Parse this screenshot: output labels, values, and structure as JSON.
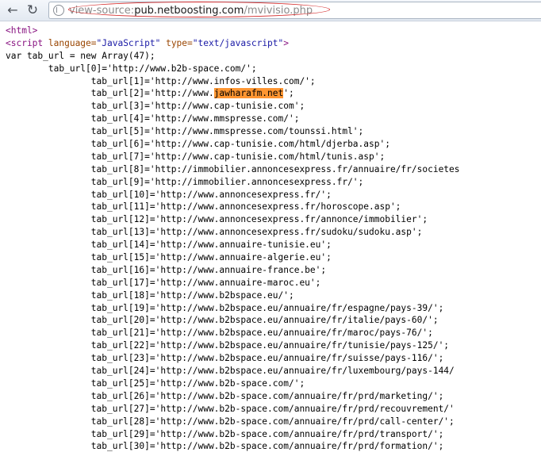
{
  "toolbar": {
    "back_icon": "back-arrow-icon",
    "reload_icon": "reload-icon",
    "page_icon": "page-info-icon"
  },
  "address": {
    "scheme": "view-source:",
    "host": "pub.netboosting.com",
    "path": "/mvivisio.php",
    "highlight_color": "#d42a2a"
  },
  "source": {
    "html_open": "<html>",
    "script_open": "<script language=\"JavaScript\" type=\"text/javascript\">",
    "array_decl": "var tab_url = new Array(47);",
    "first_line": "        tab_url[0]='http://www.b2b-space.com/';",
    "highlight_term": "jawharafm.net",
    "highlight_color": "#ff9632",
    "entries": [
      "tab_url[1]='http://www.infos-villes.com/';",
      "tab_url[2]='http://www.jawharafm.net';",
      "tab_url[3]='http://www.cap-tunisie.com';",
      "tab_url[4]='http://www.mmspresse.com/';",
      "tab_url[5]='http://www.mmspresse.com/tounssi.html';",
      "tab_url[6]='http://www.cap-tunisie.com/html/djerba.asp';",
      "tab_url[7]='http://www.cap-tunisie.com/html/tunis.asp';",
      "tab_url[8]='http://immobilier.annoncesexpress.fr/annuaire/fr/societes",
      "tab_url[9]='http://immobilier.annoncesexpress.fr/';",
      "tab_url[10]='http://www.annoncesexpress.fr/';",
      "tab_url[11]='http://www.annoncesexpress.fr/horoscope.asp';",
      "tab_url[12]='http://www.annoncesexpress.fr/annonce/immobilier';",
      "tab_url[13]='http://www.annoncesexpress.fr/sudoku/sudoku.asp';",
      "tab_url[14]='http://www.annuaire-tunisie.eu';",
      "tab_url[15]='http://www.annuaire-algerie.eu';",
      "tab_url[16]='http://www.annuaire-france.be';",
      "tab_url[17]='http://www.annuaire-maroc.eu';",
      "tab_url[18]='http://www.b2bspace.eu/';",
      "tab_url[19]='http://www.b2bspace.eu/annuaire/fr/espagne/pays-39/';",
      "tab_url[20]='http://www.b2bspace.eu/annuaire/fr/italie/pays-60/';",
      "tab_url[21]='http://www.b2bspace.eu/annuaire/fr/maroc/pays-76/';",
      "tab_url[22]='http://www.b2bspace.eu/annuaire/fr/tunisie/pays-125/';",
      "tab_url[23]='http://www.b2bspace.eu/annuaire/fr/suisse/pays-116/';",
      "tab_url[24]='http://www.b2bspace.eu/annuaire/fr/luxembourg/pays-144/",
      "tab_url[25]='http://www.b2b-space.com/';",
      "tab_url[26]='http://www.b2b-space.com/annuaire/fr/prd/marketing/';",
      "tab_url[27]='http://www.b2b-space.com/annuaire/fr/prd/recouvrement/'",
      "tab_url[28]='http://www.b2b-space.com/annuaire/fr/prd/call-center/';",
      "tab_url[29]='http://www.b2b-space.com/annuaire/fr/prd/transport/';",
      "tab_url[30]='http://www.b2b-space.com/annuaire/fr/prd/formation/';"
    ]
  }
}
